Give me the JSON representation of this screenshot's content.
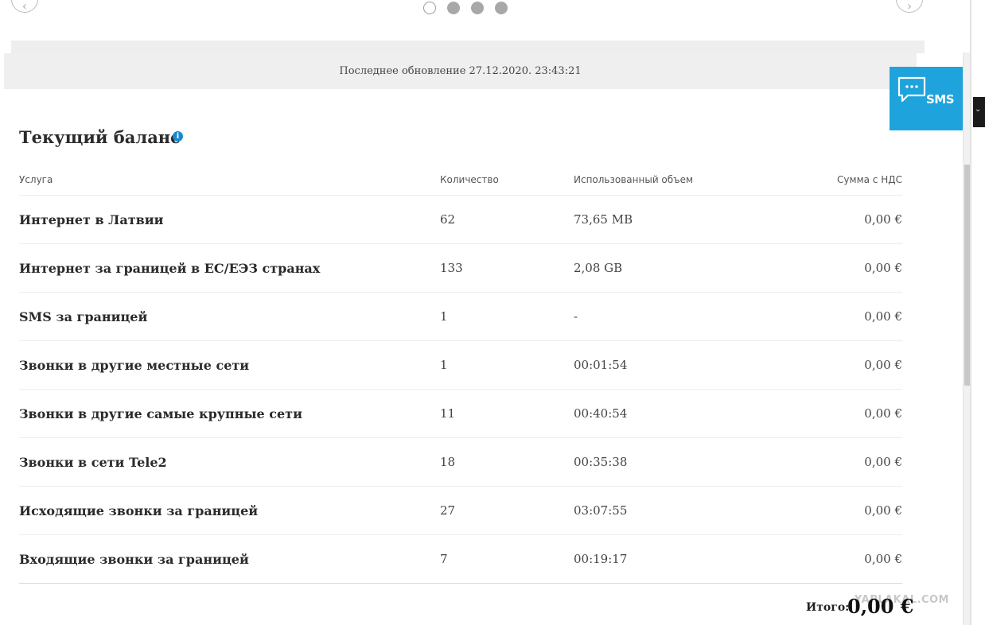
{
  "carousel": {
    "prev_icon": "chevron-left-icon",
    "next_icon": "chevron-right-icon",
    "dots": 4,
    "active_dot": 0
  },
  "last_update": "Последнее обновление 27.12.2020. 23:43:21",
  "sms_widget": {
    "label": "SMS",
    "icon": "chat-bubble-icon",
    "color": "#1ea3dc"
  },
  "balance": {
    "title": "Текущий баланс",
    "info_icon": "i",
    "columns": [
      "Услуга",
      "Количество",
      "Использованный объем",
      "Сумма с НДС"
    ],
    "rows": [
      [
        "Интернет в Латвии",
        "62",
        "73,65 MB",
        "0,00 €"
      ],
      [
        "Интернет за границей в ЕС/ЕЭЗ странах",
        "133",
        "2,08 GB",
        "0,00 €"
      ],
      [
        "SMS за границей",
        "1",
        "-",
        "0,00 €"
      ],
      [
        "Звонки в другие местные сети",
        "1",
        "00:01:54",
        "0,00 €"
      ],
      [
        "Звонки в другие самые крупные сети",
        "11",
        "00:40:54",
        "0,00 €"
      ],
      [
        "Звонки в сети Tele2",
        "18",
        "00:35:38",
        "0,00 €"
      ],
      [
        "Исходящие звонки за границей",
        "27",
        "03:07:55",
        "0,00 €"
      ],
      [
        "Входящие звонки за границей",
        "7",
        "00:19:17",
        "0,00 €"
      ]
    ],
    "total_label": "Итого:",
    "total_value": "0,00 €"
  },
  "watermark": "YAPLAKAL.COM"
}
